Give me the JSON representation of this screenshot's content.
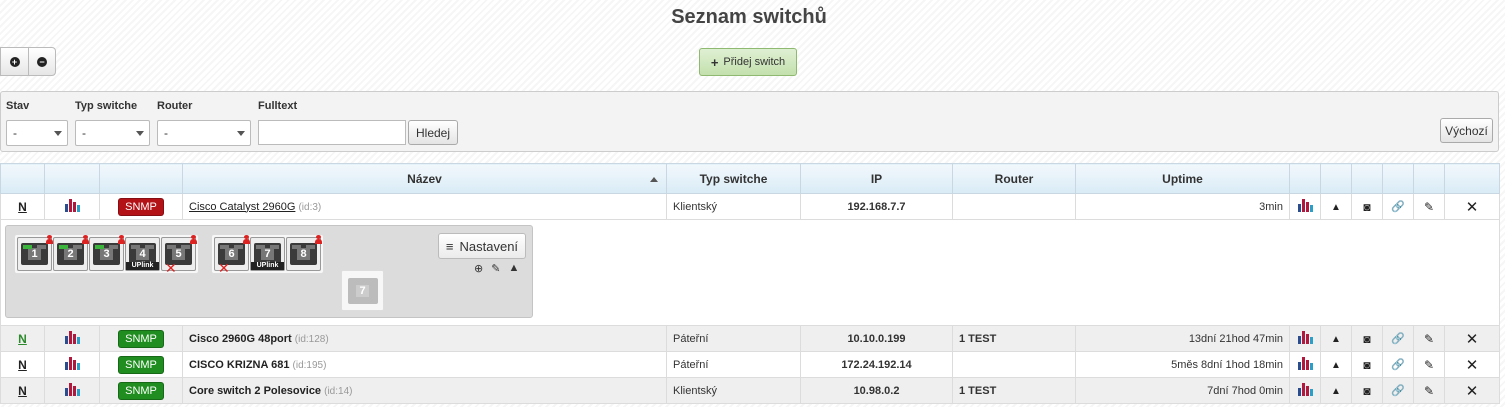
{
  "page": {
    "title": "Seznam switchů"
  },
  "toolbar": {
    "zoom_in": "+",
    "zoom_out": "−",
    "add_label": "Přidej switch"
  },
  "filters": {
    "stav": {
      "label": "Stav",
      "value": "-"
    },
    "typ": {
      "label": "Typ switche",
      "value": "-"
    },
    "router": {
      "label": "Router",
      "value": "-"
    },
    "fulltext": {
      "label": "Fulltext",
      "value": ""
    },
    "search_label": "Hledej",
    "default_label": "Výchozí"
  },
  "table": {
    "headers": {
      "name": "Název",
      "type": "Typ switche",
      "ip": "IP",
      "router": "Router",
      "uptime": "Uptime"
    },
    "rows": [
      {
        "n": "N",
        "snmp": "SNMP",
        "snmp_color": "#b31217",
        "name": "Cisco Catalyst 2960G",
        "id": "(id:3)",
        "type": "Klientský",
        "ip": "192.168.7.7",
        "router": "",
        "uptime": "3min"
      },
      {
        "n": "N",
        "snmp": "SNMP",
        "snmp_color": "#1f8d1f",
        "name": "Cisco 2960G 48port",
        "id": "(id:128)",
        "type": "Páteřní",
        "ip": "10.10.0.199",
        "router": "1 TEST",
        "uptime": "13dní 21hod 47min"
      },
      {
        "n": "N",
        "snmp": "SNMP",
        "snmp_color": "#1f8d1f",
        "name": "CISCO KRIZNA 681",
        "id": "(id:195)",
        "type": "Páteřní",
        "ip": "172.24.192.14",
        "router": "",
        "uptime": "5měs 8dní 1hod 18min"
      },
      {
        "n": "N",
        "snmp": "SNMP",
        "snmp_color": "#1f8d1f",
        "name": "Core switch 2 Polesovice",
        "id": "(id:14)",
        "type": "Klientský",
        "ip": "10.98.0.2",
        "router": "1 TEST",
        "uptime": "7dní 7hod 0min"
      }
    ]
  },
  "detail": {
    "settings_label": "Nastavení",
    "ports": [
      {
        "label": "1",
        "status": "up"
      },
      {
        "label": "2",
        "status": "up"
      },
      {
        "label": "3",
        "status": "up"
      },
      {
        "label": "4",
        "status": "uplink"
      },
      {
        "label": "5",
        "status": "down"
      },
      {
        "label": "6",
        "status": "down"
      },
      {
        "label": "7",
        "status": "uplink"
      },
      {
        "label": "8",
        "status": "user"
      }
    ],
    "empty_port_label": "7"
  }
}
